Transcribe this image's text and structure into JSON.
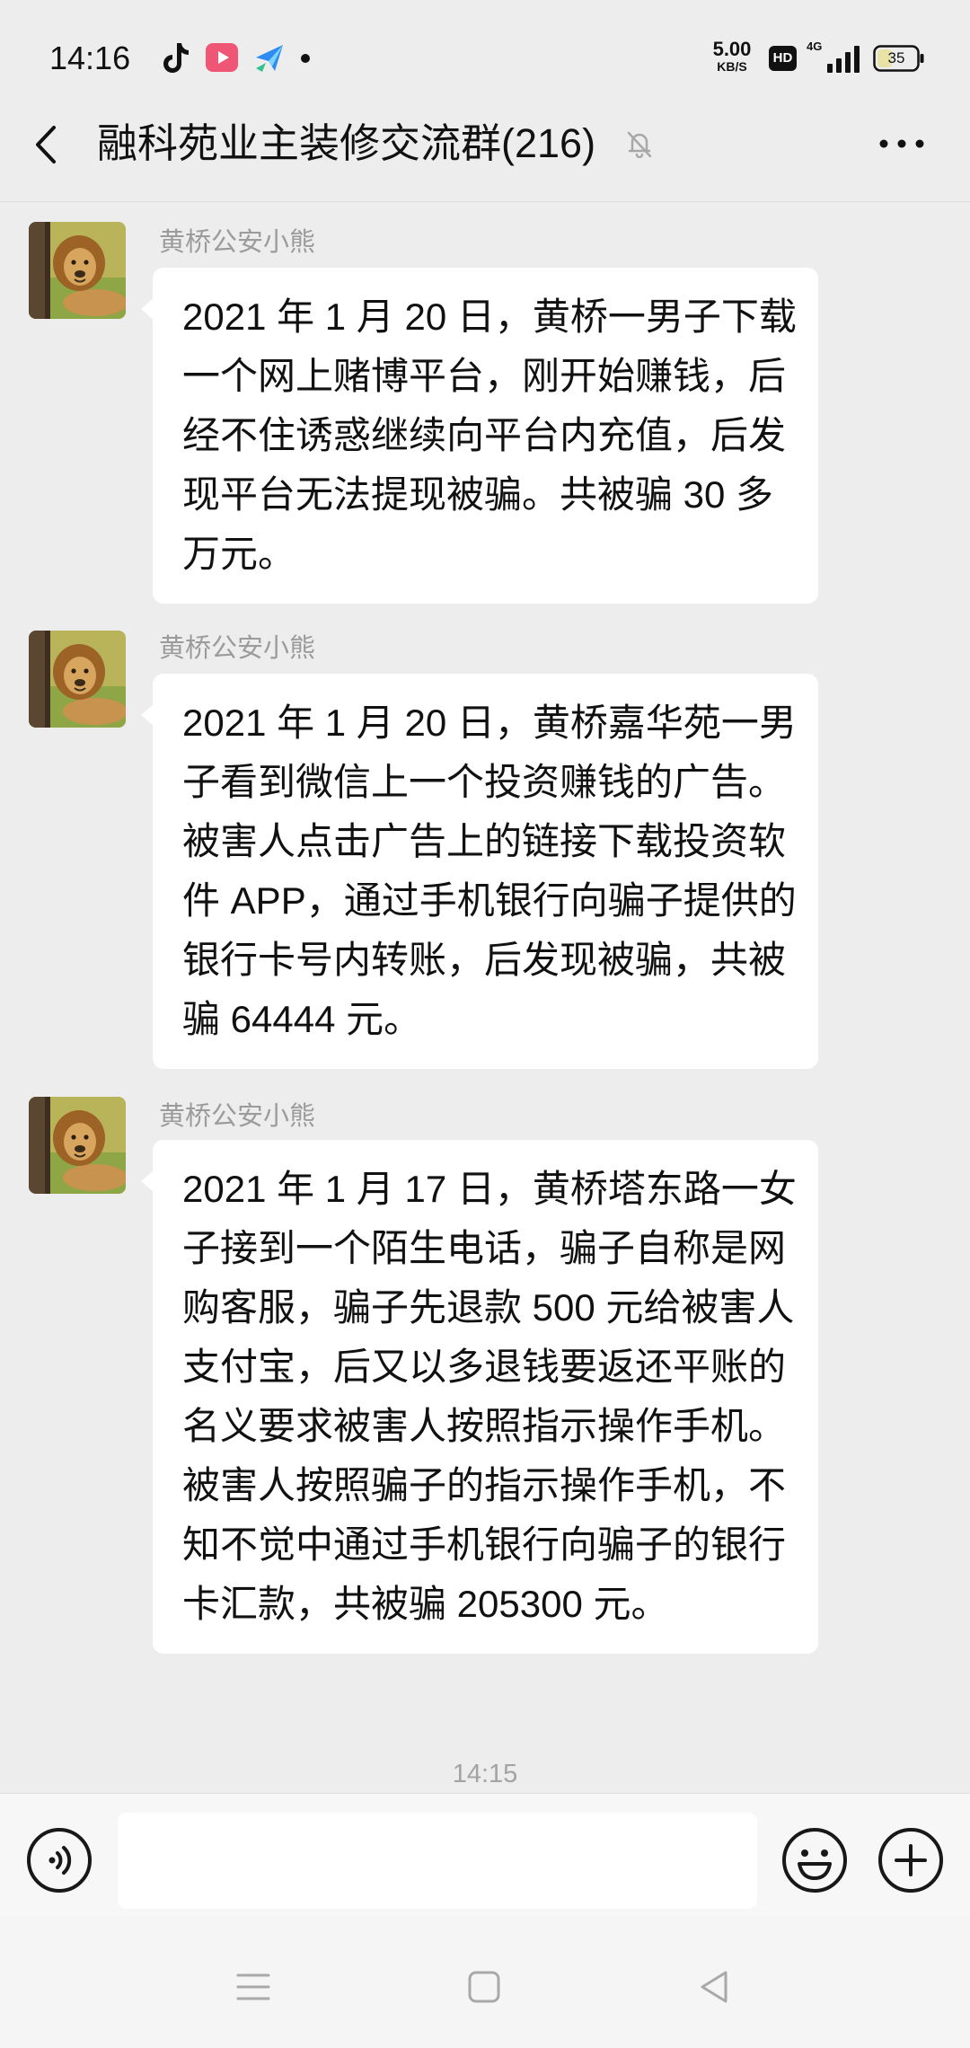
{
  "status_bar": {
    "time": "14:16",
    "net_speed_value": "5.00",
    "net_speed_unit": "KB/S",
    "hd_label": "HD",
    "network_label": "4G",
    "battery_level": "35",
    "icons": [
      "tiktok-icon",
      "video-app-icon",
      "send-app-icon",
      "notification-dot-icon",
      "signal-bars-icon",
      "battery-icon"
    ]
  },
  "header": {
    "title": "融科苑业主装修交流群(216)",
    "icons": [
      "back-chevron-icon",
      "mute-bell-icon",
      "more-dots-icon"
    ]
  },
  "messages": [
    {
      "sender": "黄桥公安小熊",
      "avatar_icon": "lion-avatar",
      "text": "2021 年 1 月 20 日，黄桥一男子下载一个网上赌博平台，刚开始赚钱，后经不住诱惑继续向平台内充值，后发现平台无法提现被骗。共被骗 30 多万元。"
    },
    {
      "sender": "黄桥公安小熊",
      "avatar_icon": "lion-avatar",
      "text": "2021 年 1 月 20 日，黄桥嘉华苑一男子看到微信上一个投资赚钱的广告。被害人点击广告上的链接下载投资软件 APP，通过手机银行向骗子提供的银行卡号内转账，后发现被骗，共被骗 64444 元。"
    },
    {
      "sender": "黄桥公安小熊",
      "avatar_icon": "lion-avatar",
      "text": "2021 年 1 月 17 日，黄桥塔东路一女子接到一个陌生电话，骗子自称是网购客服，骗子先退款 500 元给被害人支付宝，后又以多退钱要返还平账的名义要求被害人按照指示操作手机。被害人按照骗子的指示操作手机，不知不觉中通过手机银行向骗子的银行卡汇款，共被骗 205300 元。"
    }
  ],
  "timestamp": "14:15",
  "input_bar": {
    "icons": [
      "voice-icon",
      "emoji-icon",
      "plus-icon"
    ]
  },
  "nav_bar": {
    "icons": [
      "menu-icon",
      "home-square-icon",
      "back-triangle-icon"
    ]
  },
  "colors": {
    "background": "#EDEDED",
    "bubble": "#FFFFFF",
    "sender_name": "#9B9B9B",
    "input_bar": "#F7F7F7",
    "text": "#111111"
  }
}
